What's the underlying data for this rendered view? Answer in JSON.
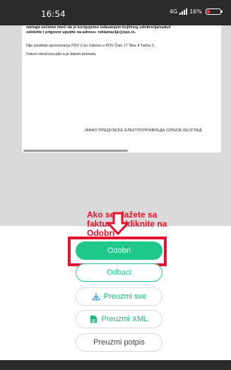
{
  "status_bar": {
    "time": "16:54",
    "network": "4G",
    "battery": "16%"
  },
  "document": {
    "bold_text": "razloga nećemo moći da je korigujemo izdavanjem knjižnog odobrenja/zaduž\nodobrite i prigovor uputite na adresu: reklamacije@eps.rs.",
    "line1": "Nije predmet oporezivanja PDV 2 po Zakonu o PDV Član 17 Stav 4 Tačka 2;",
    "line2": "Datum obračuna pdv-a je datum prometa",
    "footer": "ЈАВНО ПРЕДУЗЕЋЕ ЕЛЕКТРОПРИВРЕДА СРБИЈЕ БЕОГРАД"
  },
  "annotation": {
    "text": "Ako se slažete sa fakturom kliknite na Odobri",
    "color": "#e8112d"
  },
  "actions": {
    "approve": "Odobri",
    "reject": "Odbaci",
    "download_all": "Preuzmi sve",
    "download_xml": "Preuzmi XML",
    "download_signature": "Preuzmi potpis"
  },
  "colors": {
    "accent": "#1fc88a",
    "highlight": "#e8112d"
  }
}
